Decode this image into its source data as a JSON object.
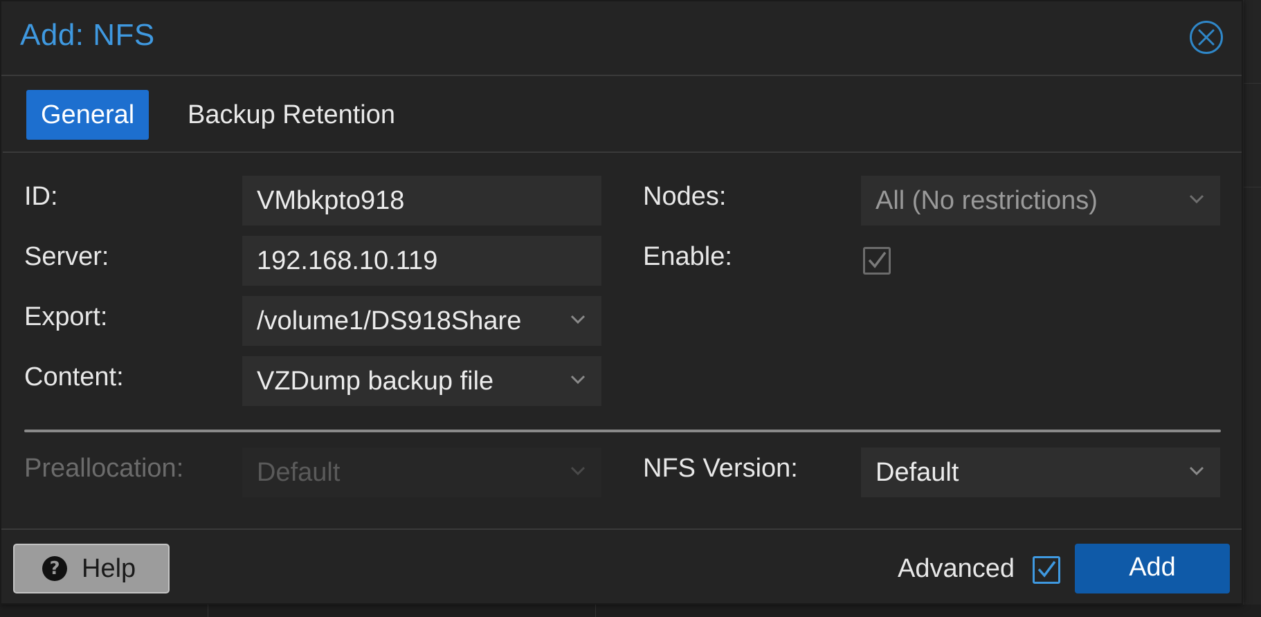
{
  "dialog": {
    "title": "Add: NFS"
  },
  "tabs": [
    {
      "label": "General",
      "active": true
    },
    {
      "label": "Backup Retention",
      "active": false
    }
  ],
  "form": {
    "id": {
      "label": "ID:",
      "value": "VMbkpto918"
    },
    "server": {
      "label": "Server:",
      "value": "192.168.10.119"
    },
    "export": {
      "label": "Export:",
      "value": "/volume1/DS918Share"
    },
    "content": {
      "label": "Content:",
      "value": "VZDump backup file"
    },
    "nodes": {
      "label": "Nodes:",
      "value": "All (No restrictions)"
    },
    "enable": {
      "label": "Enable:",
      "checked": true
    },
    "preallocation": {
      "label": "Preallocation:",
      "value": "Default",
      "disabled": true
    },
    "nfs_version": {
      "label": "NFS Version:",
      "value": "Default"
    }
  },
  "footer": {
    "help_label": "Help",
    "advanced_label": "Advanced",
    "advanced_checked": true,
    "add_label": "Add"
  },
  "colors": {
    "accent": "#3f99e0",
    "active_tab": "#1d6fcf",
    "primary_button": "#0f5aa8",
    "background": "#242424"
  }
}
